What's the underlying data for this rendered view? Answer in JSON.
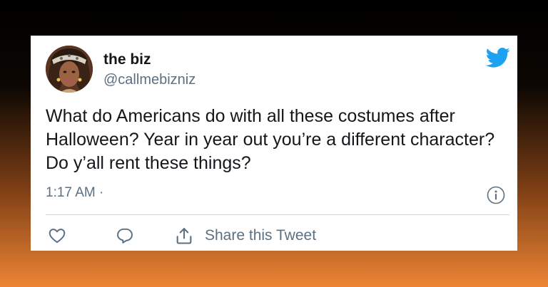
{
  "tweet": {
    "author": {
      "display_name": "the biz",
      "handle": "@callmebizniz",
      "avatar_icon": "user-avatar"
    },
    "text": "What do Americans do with all these costumes after Halloween? Year in year out you’re a different character? Do y’all rent these things?",
    "timestamp": "1:17 AM ·",
    "actions": {
      "share_label": "Share this Tweet"
    },
    "icons": [
      "twitter-bird-icon",
      "info-icon",
      "heart-icon",
      "reply-icon",
      "share-icon"
    ],
    "colors": {
      "twitter_blue": "#1da1f2",
      "text": "#14171a",
      "secondary": "#5b7083"
    }
  }
}
